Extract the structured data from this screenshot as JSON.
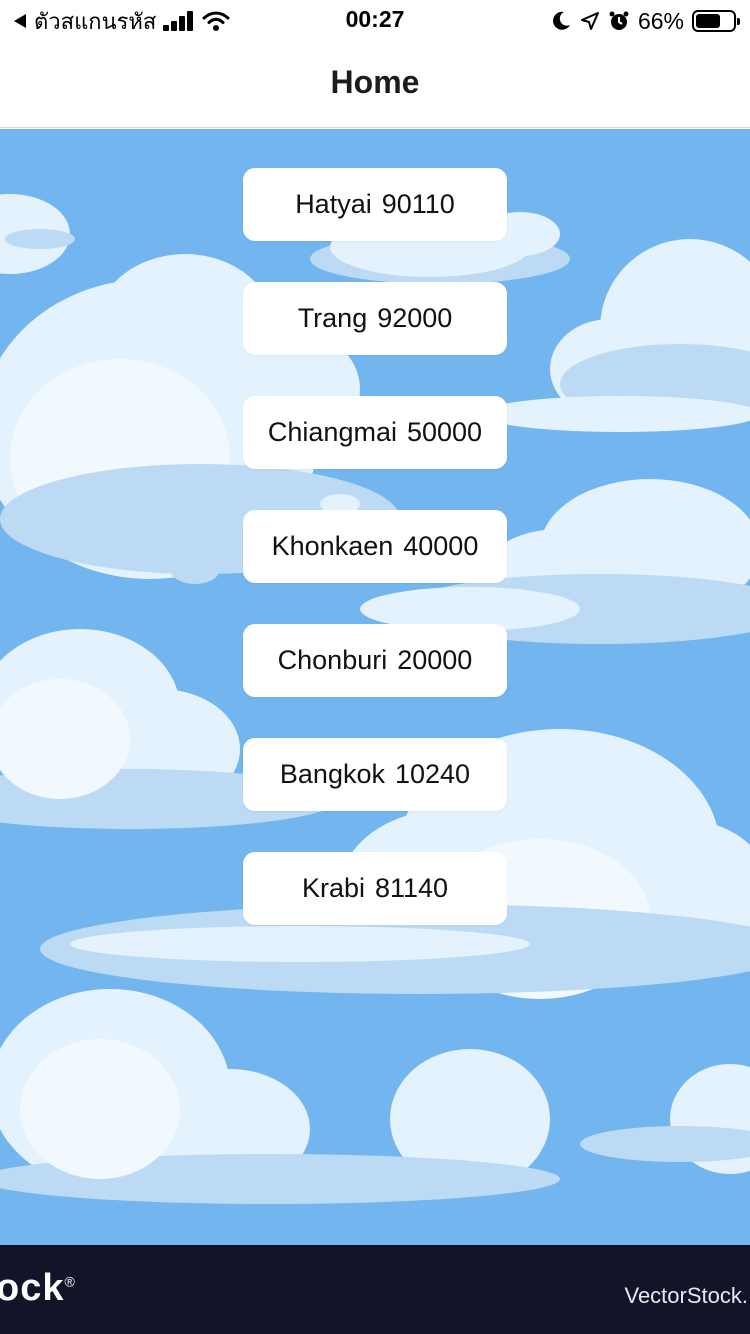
{
  "status_bar": {
    "carrier": "ตัวสแกนรหัส",
    "time": "00:27",
    "battery": "66%",
    "battery_level": 0.66
  },
  "nav": {
    "title": "Home"
  },
  "cities": [
    {
      "name": "Hatyai",
      "zip": "90110"
    },
    {
      "name": "Trang",
      "zip": "92000"
    },
    {
      "name": "Chiangmai",
      "zip": "50000"
    },
    {
      "name": "Khonkaen",
      "zip": "40000"
    },
    {
      "name": "Chonburi",
      "zip": "20000"
    },
    {
      "name": "Bangkok",
      "zip": "10240"
    },
    {
      "name": "Krabi",
      "zip": "81140"
    }
  ],
  "watermark": {
    "left": "ock",
    "left_mark": "®",
    "right": "VectorStock."
  },
  "colors": {
    "sky": "#72b5ef",
    "cloud": "#e3f2fc",
    "cloud_shade": "#bcdaf4",
    "footer": "#12142a"
  }
}
